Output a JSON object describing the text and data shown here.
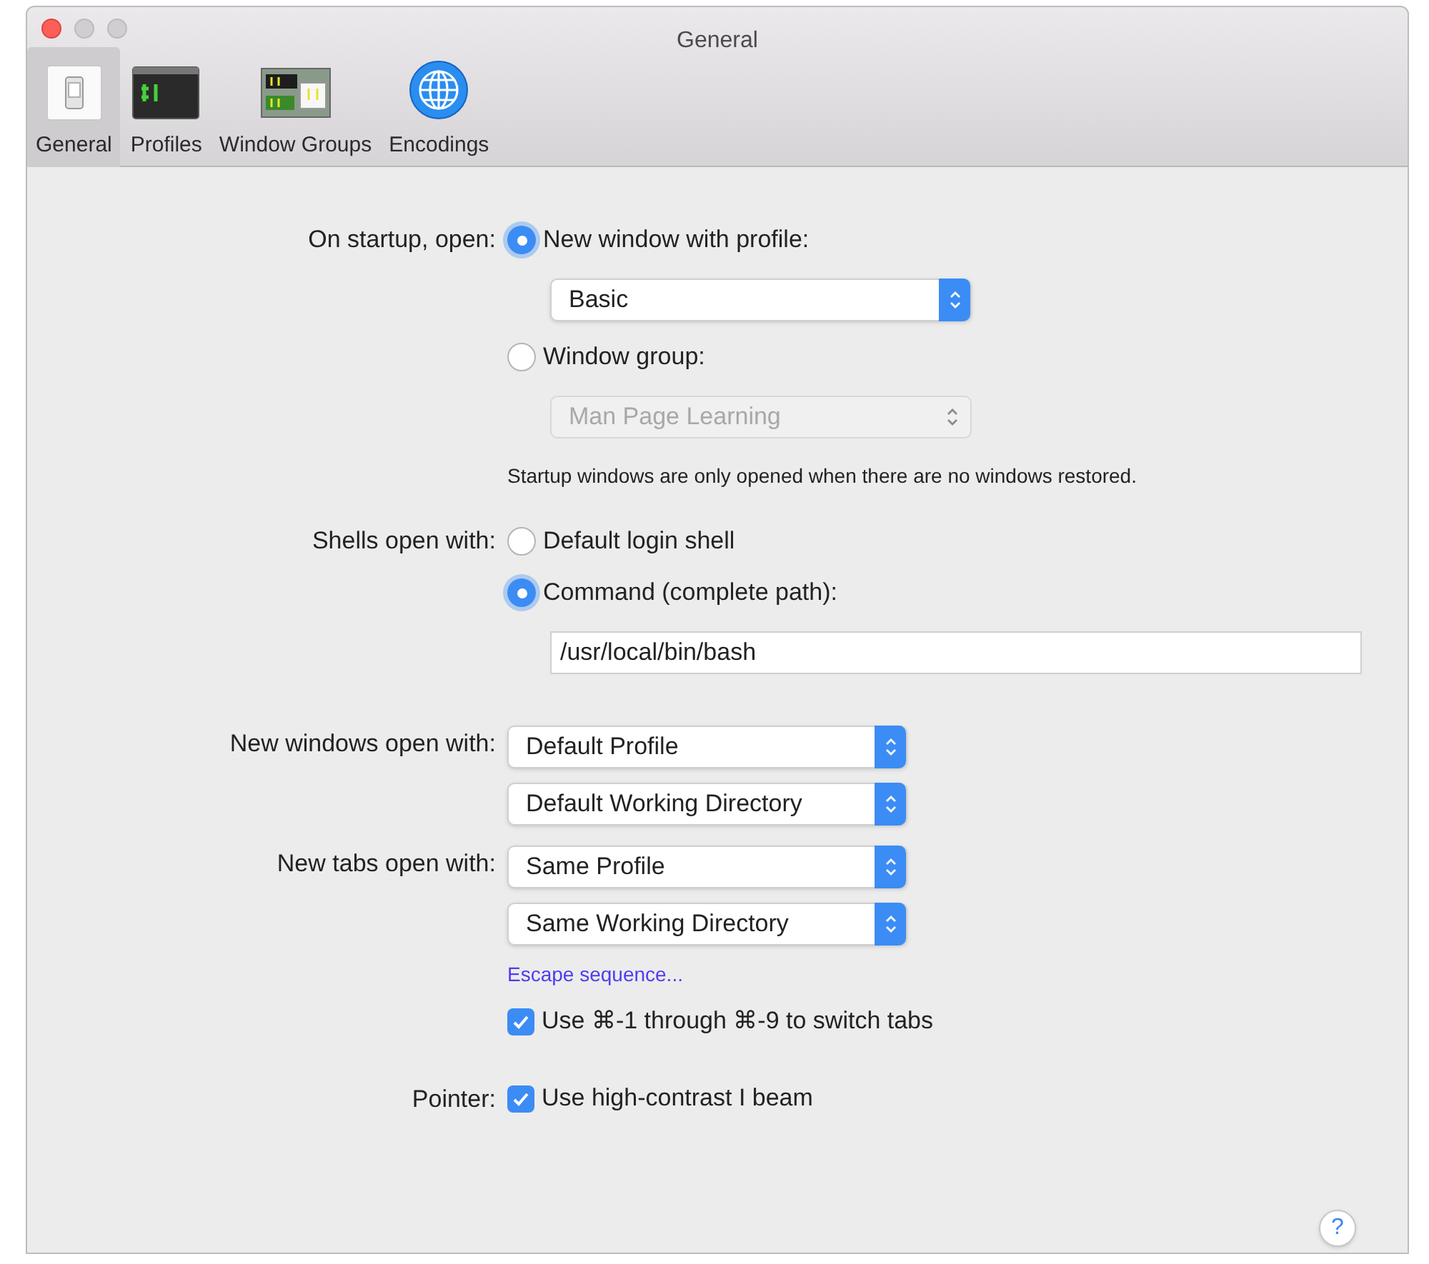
{
  "window": {
    "title": "General"
  },
  "toolbar": [
    {
      "label": "General",
      "selected": true,
      "kind": "switch"
    },
    {
      "label": "Profiles",
      "selected": false,
      "kind": "terminal"
    },
    {
      "label": "Window Groups",
      "selected": false,
      "kind": "groups"
    },
    {
      "label": "Encodings",
      "selected": false,
      "kind": "globe"
    }
  ],
  "settings": [
    {
      "label": "On startup, open:",
      "items": [
        {
          "kind": "radio",
          "label": "New window with profile:",
          "selected": true,
          "children": [
            {
              "kind": "popup",
              "value": "Basic",
              "disabled": false
            }
          ]
        },
        {
          "kind": "radio",
          "label": "Window group:",
          "selected": false,
          "children": [
            {
              "kind": "popup",
              "value": "Man Page Learning",
              "disabled": true
            }
          ]
        },
        {
          "kind": "note",
          "label": "Startup windows are only opened when there are no windows restored."
        }
      ]
    },
    {
      "label": "Shells open with:",
      "items": [
        {
          "kind": "radio",
          "label": "Default login shell",
          "selected": false
        },
        {
          "kind": "radio",
          "label": "Command (complete path):",
          "selected": true,
          "children": [
            {
              "kind": "field",
              "value": "/usr/local/bin/bash"
            }
          ]
        }
      ]
    },
    {
      "label": "New windows open with:",
      "items": [
        {
          "kind": "popup",
          "value": "Default Profile",
          "disabled": false
        },
        {
          "kind": "popup",
          "value": "Default Working Directory",
          "disabled": false
        }
      ]
    },
    {
      "label": "New tabs open with:",
      "items": [
        {
          "kind": "popup",
          "value": "Same Profile",
          "disabled": false
        },
        {
          "kind": "popup",
          "value": "Same Working Directory",
          "disabled": false
        },
        {
          "kind": "link",
          "label": "Escape sequence..."
        },
        {
          "kind": "checkbox",
          "label": "Use ⌘-1 through ⌘-9 to switch tabs",
          "checked": true
        }
      ]
    },
    {
      "label": "Pointer:",
      "items": [
        {
          "kind": "checkbox",
          "label": "Use high-contrast I beam",
          "checked": true
        }
      ]
    }
  ],
  "help": {
    "label": "?"
  }
}
